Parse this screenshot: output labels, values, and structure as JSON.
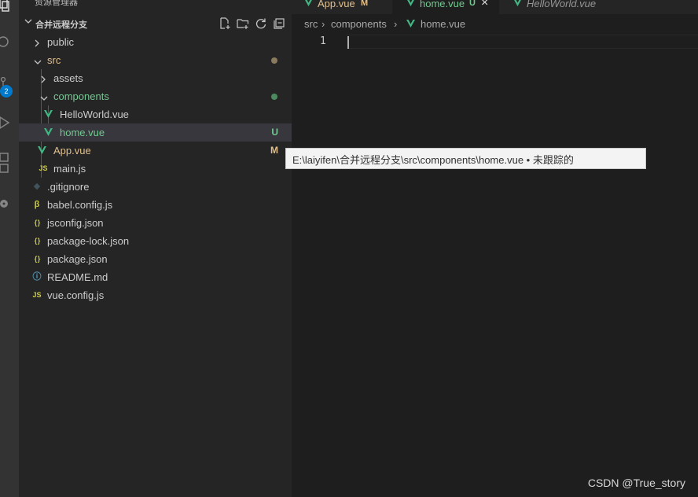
{
  "activity_bar": {
    "icons": [
      "explorer-icon",
      "search-icon",
      "source-control-icon",
      "run-debug-icon",
      "extensions-icon",
      "remote-icon"
    ],
    "source_control_badge": "2"
  },
  "sidebar": {
    "title": "资源管理器",
    "more": "···",
    "folder_name": "合并远程分支",
    "actions": [
      "new-file-icon",
      "new-folder-icon",
      "refresh-icon",
      "collapse-all-icon"
    ]
  },
  "tree": [
    {
      "label": "public",
      "kind": "folder",
      "expanded": false,
      "color": "#cccccc"
    },
    {
      "label": "src",
      "kind": "folder",
      "expanded": true,
      "color": "#e2c08d",
      "dot_color": "#8a7a5e"
    },
    {
      "label": "assets",
      "kind": "folder",
      "expanded": false,
      "color": "#cccccc"
    },
    {
      "label": "components",
      "kind": "folder",
      "expanded": true,
      "color": "#73c991",
      "dot_color": "#4b8b5f"
    },
    {
      "label": "HelloWorld.vue",
      "kind": "vue",
      "color": "#cccccc"
    },
    {
      "label": "home.vue",
      "kind": "vue",
      "color": "#73c991",
      "decoration": "U",
      "decoration_color": "#73c991",
      "selected": true
    },
    {
      "label": "App.vue",
      "kind": "vue",
      "color": "#e2c08d",
      "decoration": "M",
      "decoration_color": "#e2c08d"
    },
    {
      "label": "main.js",
      "kind": "js",
      "color": "#cccccc"
    },
    {
      "label": ".gitignore",
      "kind": "git",
      "color": "#cccccc"
    },
    {
      "label": "babel.config.js",
      "kind": "babel",
      "color": "#cccccc"
    },
    {
      "label": "jsconfig.json",
      "kind": "json",
      "color": "#cccccc"
    },
    {
      "label": "package-lock.json",
      "kind": "json",
      "color": "#cccccc"
    },
    {
      "label": "package.json",
      "kind": "json",
      "color": "#cccccc"
    },
    {
      "label": "README.md",
      "kind": "info",
      "color": "#cccccc"
    },
    {
      "label": "vue.config.js",
      "kind": "js",
      "color": "#cccccc"
    }
  ],
  "tabs": [
    {
      "label": "App.vue",
      "status": "M",
      "color": "#e2c08d"
    },
    {
      "label": "home.vue",
      "status": "U",
      "color": "#73c991",
      "close": "×",
      "active": true
    },
    {
      "label": "HelloWorld.vue",
      "color": "#969696",
      "italic": true
    }
  ],
  "breadcrumb": {
    "parts": [
      "src",
      "components",
      "home.vue"
    ],
    "separator": "›"
  },
  "editor": {
    "line_number": "1"
  },
  "tooltip": {
    "text": "E:\\laiyifen\\合并远程分支\\src\\components\\home.vue • 未跟踪的"
  },
  "watermark": "CSDN @True_story",
  "colors": {
    "vue_green": "#41b883",
    "js_yellow": "#cbcb41",
    "json_yellow": "#cbcb41",
    "info_blue": "#519aba",
    "git_gray": "#41535b"
  }
}
